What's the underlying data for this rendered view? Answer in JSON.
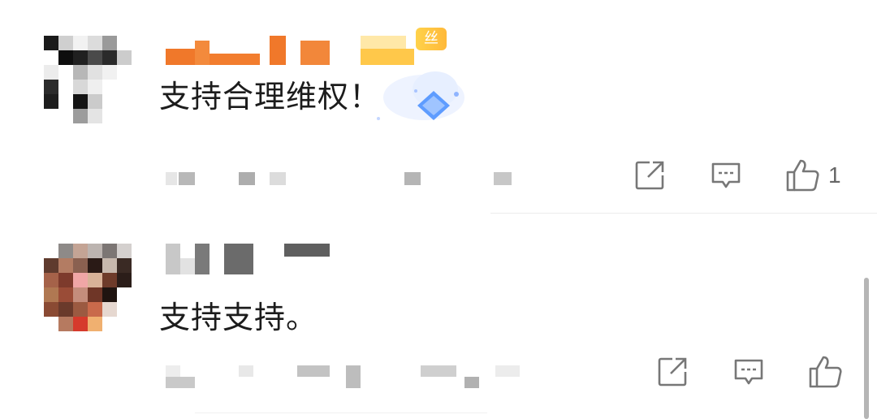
{
  "comments": [
    {
      "content": "支持合理维权！",
      "badge": "丝",
      "actions": {
        "share_icon": "share-icon",
        "reply_icon": "comment-icon",
        "like_icon": "thumbs-up-icon",
        "like_count": "1"
      }
    },
    {
      "content": "支持支持。",
      "actions": {
        "share_icon": "share-icon",
        "reply_icon": "comment-icon",
        "like_icon": "thumbs-up-icon",
        "like_count": ""
      }
    }
  ],
  "colors": {
    "name_orange": "#f0782a",
    "name_gold": "#ffc84a",
    "icon_gray": "#777777"
  }
}
